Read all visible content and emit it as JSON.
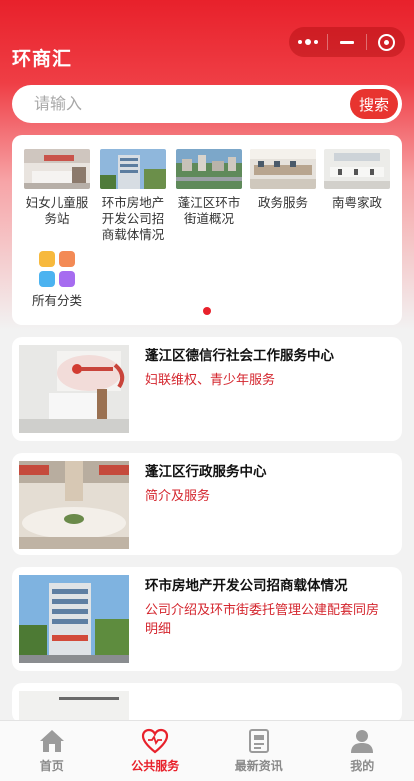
{
  "app": {
    "title": "环商汇"
  },
  "search": {
    "placeholder": "请输入",
    "button_label": "搜索"
  },
  "categories": [
    {
      "label": "妇女儿童服务站"
    },
    {
      "label": "环市房地产开发公司招商载体情况"
    },
    {
      "label": "蓬江区环市街道概况"
    },
    {
      "label": "政务服务"
    },
    {
      "label": "南粤家政"
    },
    {
      "label": "所有分类"
    }
  ],
  "listings": [
    {
      "title": "蓬江区德信行社会工作服务中心",
      "subtitle": "妇联维权、青少年服务"
    },
    {
      "title": "蓬江区行政服务中心",
      "subtitle": "简介及服务"
    },
    {
      "title": "环市房地产开发公司招商载体情况",
      "subtitle": "公司介绍及环市街委托管理公建配套同房明细"
    }
  ],
  "tabbar": {
    "items": [
      {
        "label": "首页",
        "icon": "home-icon"
      },
      {
        "label": "公共服务",
        "icon": "heart-icon"
      },
      {
        "label": "最新资讯",
        "icon": "news-icon"
      },
      {
        "label": "我的",
        "icon": "user-icon"
      }
    ],
    "active_index": 1
  },
  "colors": {
    "accent": "#e8212b",
    "subtitle": "#d4262e"
  }
}
